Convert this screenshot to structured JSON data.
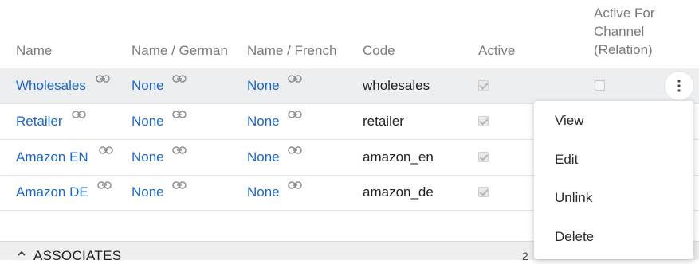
{
  "columns": {
    "name": "Name",
    "name_german": "Name / German",
    "name_french": "Name / French",
    "code": "Code",
    "active": "Active",
    "active_for_channel_1": "Active For",
    "active_for_channel_2": "Channel",
    "active_for_channel_3": "(Relation)"
  },
  "rows": [
    {
      "name": "Wholesales",
      "german": "None",
      "french": "None",
      "code": "wholesales",
      "active": true,
      "relation_active": false
    },
    {
      "name": "Retailer",
      "german": "None",
      "french": "None",
      "code": "retailer",
      "active": true
    },
    {
      "name": "Amazon EN",
      "german": "None",
      "french": "None",
      "code": "amazon_en",
      "active": true
    },
    {
      "name": "Amazon DE",
      "german": "None",
      "french": "None",
      "code": "amazon_de",
      "active": true
    }
  ],
  "menu": {
    "view": "View",
    "edit": "Edit",
    "unlink": "Unlink",
    "delete": "Delete"
  },
  "footer": {
    "title": "ASSOCIATES",
    "count": "2"
  },
  "icons": {
    "link": "link-icon",
    "kebab": "more-vertical-icon",
    "caret": "chevron-up-icon"
  },
  "colors": {
    "link": "#1a66c6",
    "header_text": "#7a7a7a",
    "hover_row": "#eceeef"
  }
}
